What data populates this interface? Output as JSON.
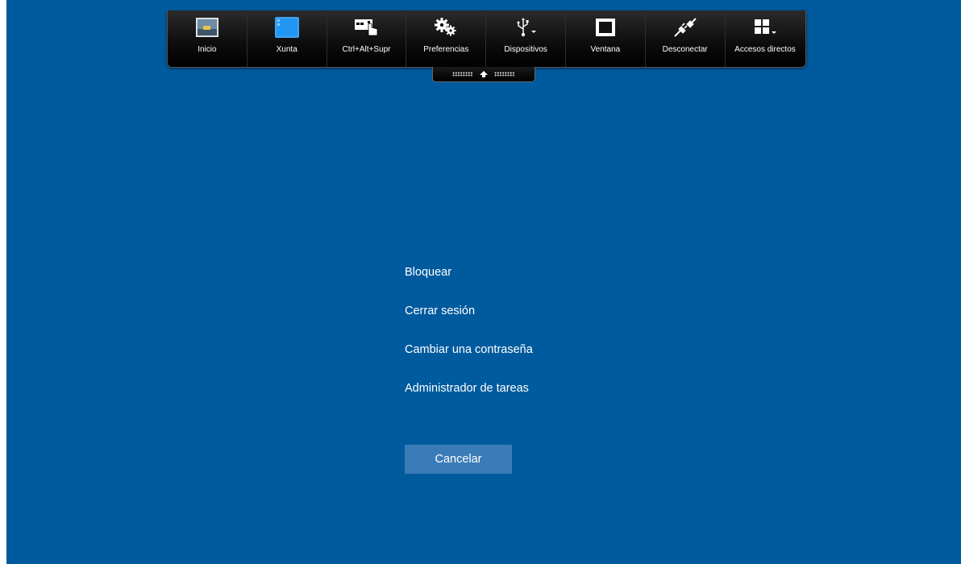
{
  "toolbar": {
    "items": [
      {
        "label": "Inicio",
        "icon": "home-screenshot-icon"
      },
      {
        "label": "Xunta",
        "icon": "desktop-window-icon"
      },
      {
        "label": "Ctrl+Alt+Supr",
        "icon": "keyboard-hand-icon"
      },
      {
        "label": "Preferencias",
        "icon": "gears-icon"
      },
      {
        "label": "Dispositivos",
        "icon": "usb-icon"
      },
      {
        "label": "Ventana",
        "icon": "window-frame-icon"
      },
      {
        "label": "Desconectar",
        "icon": "plug-disconnect-icon"
      },
      {
        "label": "Accesos directos",
        "icon": "grid-shortcuts-icon"
      }
    ]
  },
  "menu": {
    "items": [
      "Bloquear",
      "Cerrar sesión",
      "Cambiar una contraseña",
      "Administrador de tareas"
    ],
    "cancel_label": "Cancelar"
  },
  "colors": {
    "background": "#005a9e",
    "cancel_button": "#3a7cb8",
    "toolbar": "#0c0c0c"
  }
}
